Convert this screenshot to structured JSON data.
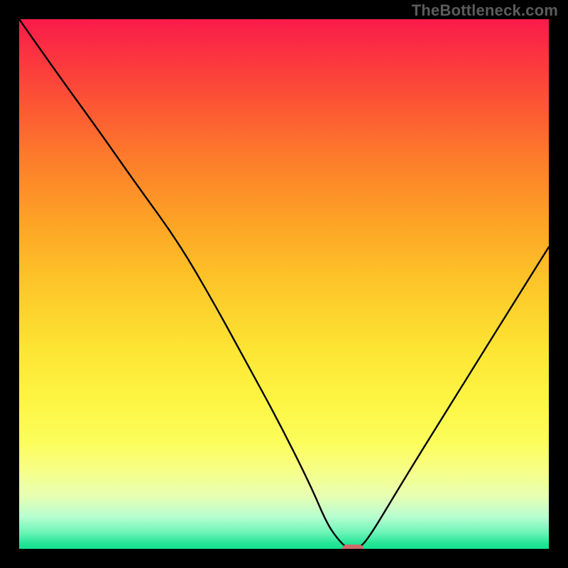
{
  "attribution": "TheBottleneck.com",
  "chart_data": {
    "type": "line",
    "title": "",
    "xlabel": "",
    "ylabel": "",
    "xlim": [
      0,
      100
    ],
    "ylim": [
      0,
      100
    ],
    "series": [
      {
        "name": "bottleneck-curve",
        "x": [
          0,
          7,
          15,
          22,
          30,
          37,
          43,
          49,
          55,
          58,
          60,
          62,
          64,
          66,
          72,
          80,
          100
        ],
        "y": [
          100,
          90,
          79,
          69,
          58,
          46,
          35,
          24,
          12,
          5,
          2,
          0,
          0,
          2,
          12,
          25,
          57
        ]
      }
    ],
    "marker": {
      "x": 63,
      "y": 0,
      "color": "#cf6a6b"
    },
    "background_gradient": {
      "direction": "top-to-bottom",
      "stops": [
        {
          "pct": 0,
          "color": "#f91b4a"
        },
        {
          "pct": 15,
          "color": "#fc5135"
        },
        {
          "pct": 38,
          "color": "#fda225"
        },
        {
          "pct": 62,
          "color": "#fde433"
        },
        {
          "pct": 85,
          "color": "#f7ff85"
        },
        {
          "pct": 97,
          "color": "#6af4b7"
        },
        {
          "pct": 100,
          "color": "#14e28f"
        }
      ]
    }
  }
}
